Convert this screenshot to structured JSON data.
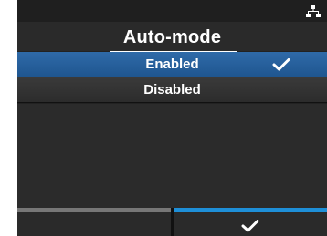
{
  "header": {
    "title": "Auto-mode",
    "status_icon": "network-icon"
  },
  "options": [
    {
      "label": "Enabled",
      "selected": true,
      "icon": "check-icon"
    },
    {
      "label": "Disabled",
      "selected": false
    }
  ],
  "softkeys": {
    "left": {
      "label": ""
    },
    "right": {
      "icon": "check-icon"
    }
  },
  "colors": {
    "background": "#222222",
    "selected": "#2a619c",
    "accent": "#1e8fd8",
    "text": "#ffffff"
  }
}
